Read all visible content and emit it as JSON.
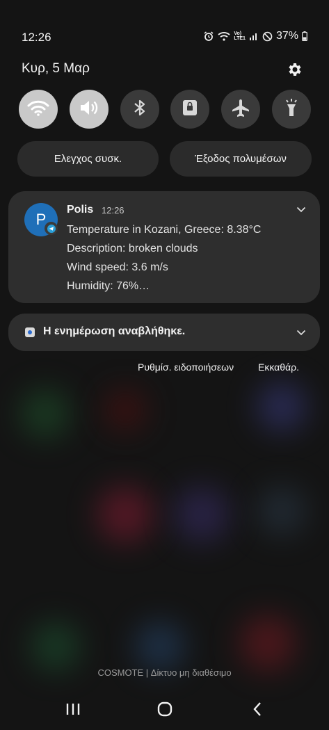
{
  "status_bar": {
    "time": "12:26",
    "icons": [
      "alarm-icon",
      "wifi-icon",
      "volte-icon",
      "signal-icon",
      "do-not-disturb-icon"
    ],
    "volte_label": "Vo)\nLTE1",
    "battery_percent": "37%"
  },
  "header": {
    "date": "Κυρ, 5 Μαρ",
    "settings_icon": "gear-icon"
  },
  "quick_settings": [
    {
      "name": "wifi",
      "icon": "wifi-icon",
      "on": true
    },
    {
      "name": "sound",
      "icon": "volume-icon",
      "on": true
    },
    {
      "name": "bluetooth",
      "icon": "bluetooth-icon",
      "on": false
    },
    {
      "name": "rotation-lock",
      "icon": "lock-icon",
      "on": false
    },
    {
      "name": "airplane",
      "icon": "airplane-icon",
      "on": false
    },
    {
      "name": "flashlight",
      "icon": "flashlight-icon",
      "on": false
    }
  ],
  "pills": {
    "device_control": "Ελεγχος συσκ.",
    "media_output": "Έξοδος πολυμέσων"
  },
  "notification": {
    "avatar_letter": "P",
    "app_name": "Polis",
    "time": "12:26",
    "lines": [
      "Temperature in Kozani, Greece: 8.38°C",
      "Description: broken clouds",
      "Wind speed: 3.6 m/s",
      "Humidity: 76%…"
    ]
  },
  "snoozed": {
    "text": "Η ενημέρωση αναβλήθηκε."
  },
  "actions": {
    "notification_settings": "Ρυθμίσ. ειδοποιήσεων",
    "clear": "Εκκαθάρ."
  },
  "carrier": "COSMOTE | Δίκτυο μη διαθέσιμο",
  "colors": {
    "accent_avatar": "#1f6fb8",
    "tile_on": "#c9c9c9",
    "tile_off": "#3a3a3a",
    "card": "#2e2e2e"
  }
}
